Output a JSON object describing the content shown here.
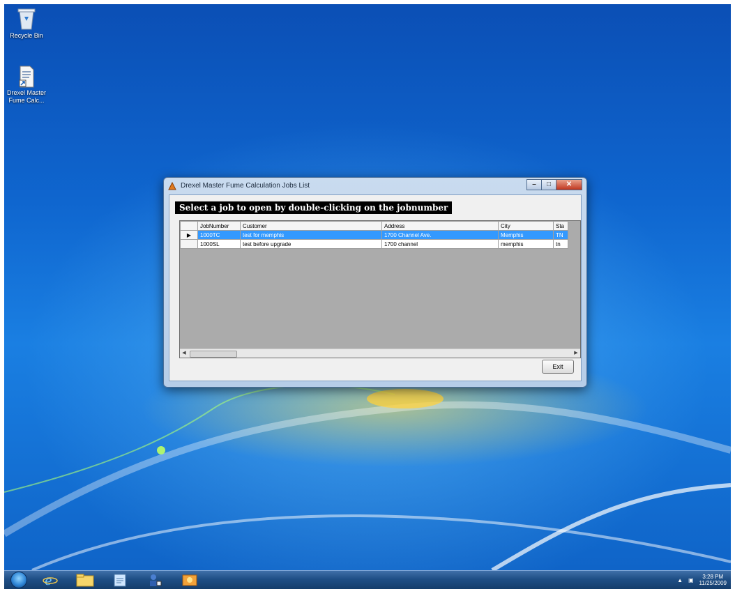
{
  "desktop": {
    "icons": [
      {
        "label": "Recycle Bin",
        "icon": "recycle-bin-icon"
      },
      {
        "label": "Drexel Master Fume Calc...",
        "icon": "shortcut-file-icon"
      }
    ]
  },
  "window": {
    "title": "Drexel Master Fume Calculation Jobs List",
    "instruction": "Select a job to open by double-clicking on the jobnumber",
    "grid": {
      "columns": [
        "JobNumber",
        "Customer",
        "Address",
        "City",
        "Sta"
      ],
      "rows": [
        {
          "selected": true,
          "marker": "▶",
          "cells": [
            "1000TC",
            "test for memphis",
            "1700 Channel Ave.",
            "Memphis",
            "TN"
          ]
        },
        {
          "selected": false,
          "marker": "",
          "cells": [
            "1000SL",
            "test before upgrade",
            "1700 channel",
            "memphis",
            "tn"
          ]
        }
      ]
    },
    "exit_label": "Exit"
  },
  "taskbar": {
    "items": [
      "start-orb-icon",
      "internet-explorer-icon",
      "file-explorer-icon",
      "notepad-icon",
      "user-app-icon",
      "media-icon"
    ],
    "clock_time": "3:28 PM",
    "clock_date": "11/25/2009"
  },
  "colors": {
    "selection": "#3399ff",
    "desktop_blue": "#0f66cf",
    "instruction_bg": "#000000"
  }
}
